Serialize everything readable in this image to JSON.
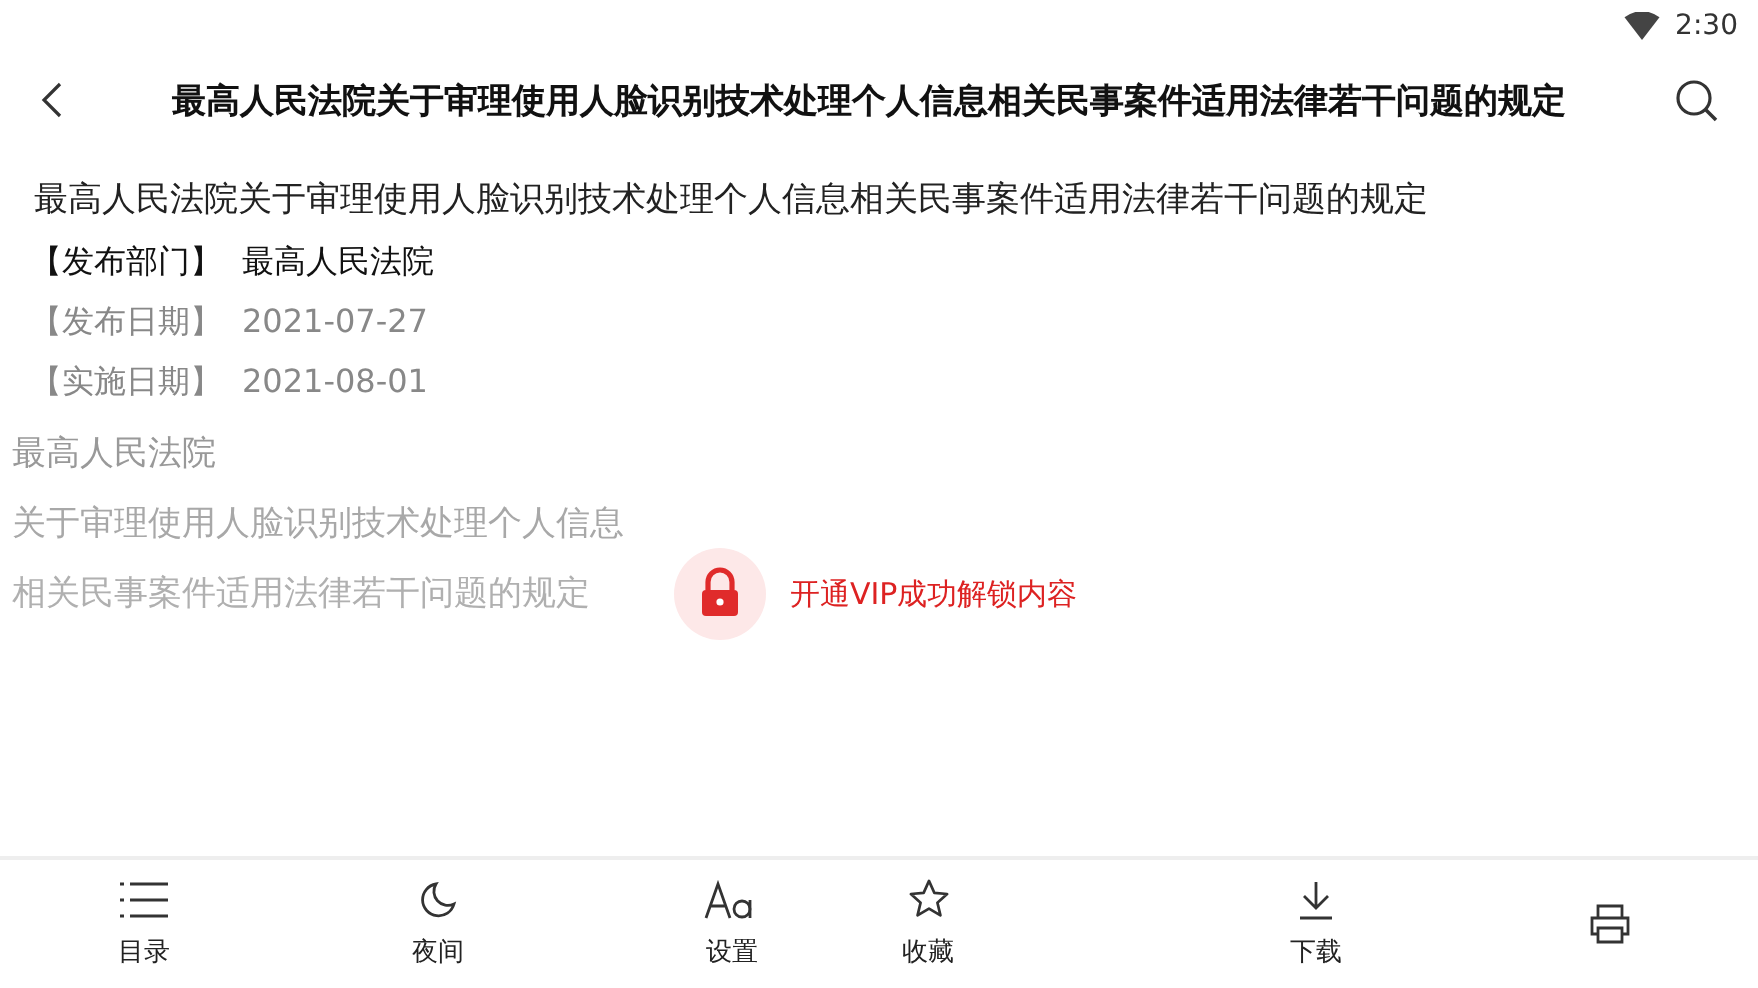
{
  "status_bar": {
    "time": "2:30"
  },
  "header": {
    "title": "最高人民法院关于审理使用人脸识别技术处理个人信息相关民事案件适用法律若干问题的规定"
  },
  "document": {
    "title": "最高人民法院关于审理使用人脸识别技术处理个人信息相关民事案件适用法律若干问题的规定",
    "meta": [
      {
        "label": "【发布部门】",
        "value": "最高人民法院",
        "emphasis": true
      },
      {
        "label": "【发布日期】",
        "value": "2021-07-27",
        "emphasis": false
      },
      {
        "label": "【实施日期】",
        "value": "2021-08-01",
        "emphasis": false
      }
    ],
    "body_lines": [
      "最高人民法院",
      "关于审理使用人脸识别技术处理个人信息",
      "相关民事案件适用法律若干问题的规定"
    ],
    "unlock_notice": "开通VIP成功解锁内容"
  },
  "toolbar": [
    {
      "kind": "list",
      "label": "目录"
    },
    {
      "kind": "moon",
      "label": "夜间"
    },
    {
      "kind": "font",
      "label": "设置"
    },
    {
      "kind": "star",
      "label": "收藏"
    },
    {
      "kind": "download",
      "label": "下载"
    },
    {
      "kind": "printer"
    }
  ]
}
